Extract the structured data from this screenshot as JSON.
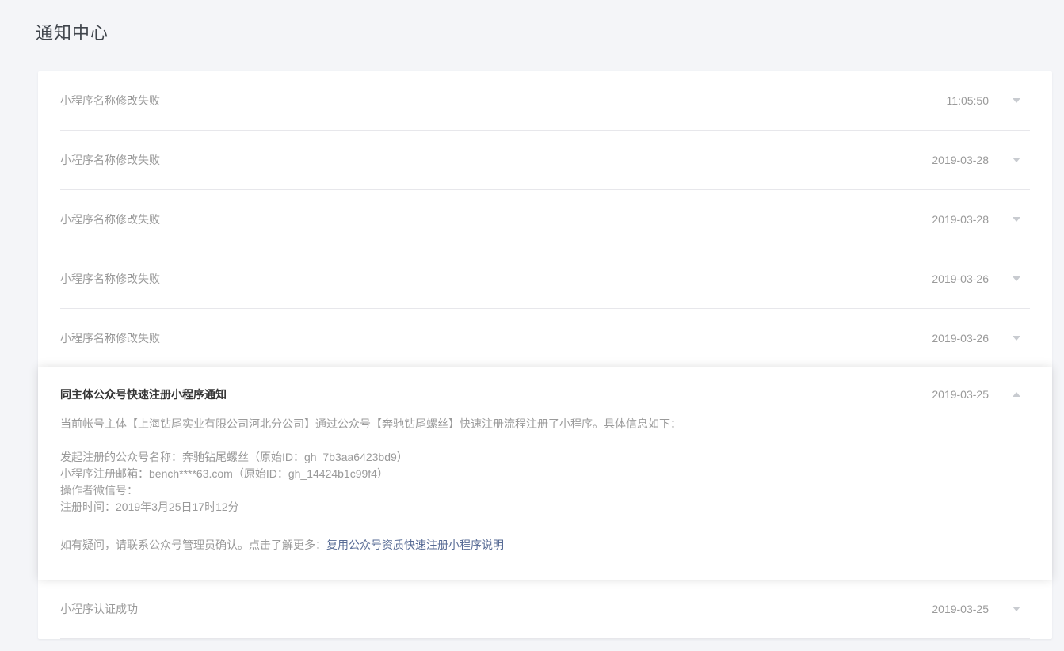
{
  "page": {
    "title": "通知中心"
  },
  "colors": {
    "page_background": "#f4f5f8",
    "card_background": "#ffffff",
    "separator": "#e7e7eb",
    "muted_text": "#9a9a9a",
    "dark_text": "#353535",
    "link": "#576b95",
    "chevron": "#c8cbd0"
  },
  "notifications": [
    {
      "title": "小程序名称修改失败",
      "date": "11:05:50",
      "expanded": false
    },
    {
      "title": "小程序名称修改失败",
      "date": "2019-03-28",
      "expanded": false
    },
    {
      "title": "小程序名称修改失败",
      "date": "2019-03-28",
      "expanded": false
    },
    {
      "title": "小程序名称修改失败",
      "date": "2019-03-26",
      "expanded": false
    },
    {
      "title": "小程序名称修改失败",
      "date": "2019-03-26",
      "expanded": false
    },
    {
      "title": "同主体公众号快速注册小程序通知",
      "date": "2019-03-25",
      "expanded": true,
      "body": {
        "intro": "当前帐号主体【上海钻尾实业有限公司河北分公司】通过公众号【奔驰钻尾螺丝】快速注册流程注册了小程序。具体信息如下：",
        "details": [
          "发起注册的公众号名称：奔驰钻尾螺丝（原始ID：gh_7b3aa6423bd9）",
          "小程序注册邮箱：bench****63.com（原始ID：gh_14424b1c99f4）",
          "操作者微信号：",
          "注册时间：2019年3月25日17时12分"
        ],
        "footer_text": "如有疑问，请联系公众号管理员确认。点击了解更多：",
        "footer_link": "复用公众号资质快速注册小程序说明"
      }
    },
    {
      "title": "小程序认证成功",
      "date": "2019-03-25",
      "expanded": false
    }
  ]
}
